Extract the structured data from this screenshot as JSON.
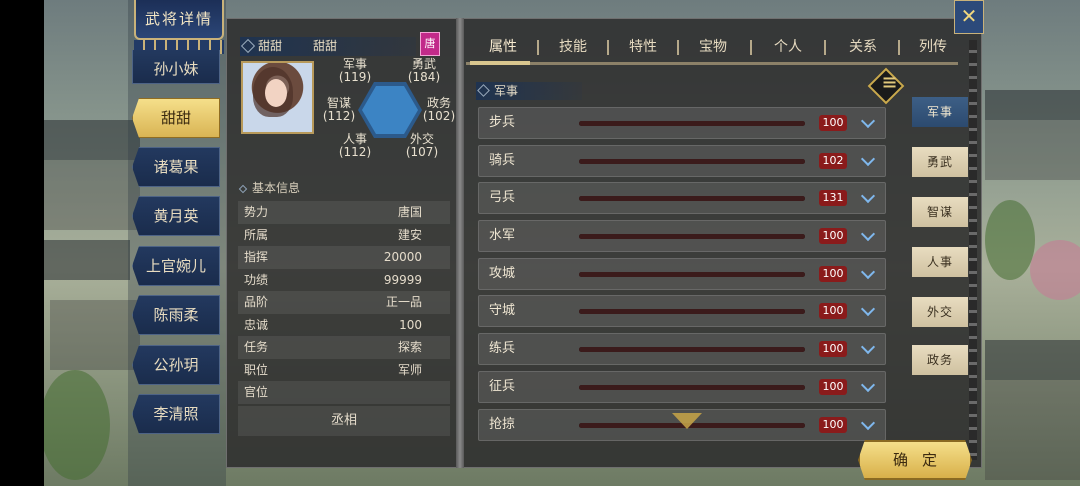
{
  "header": {
    "title": "武将详情"
  },
  "characters": [
    {
      "name": "孙小妹",
      "active": false
    },
    {
      "name": "甜甜",
      "active": true
    },
    {
      "name": "诸葛果",
      "active": false
    },
    {
      "name": "黄月英",
      "active": false
    },
    {
      "name": "上官婉儿",
      "active": false
    },
    {
      "name": "陈雨柔",
      "active": false
    },
    {
      "name": "公孙玥",
      "active": false
    },
    {
      "name": "李清照",
      "active": false
    }
  ],
  "general": {
    "name": "甜甜",
    "alt_name": "甜甜",
    "faction_badge": "唐",
    "stats": {
      "military_label": "军事",
      "military": "(119)",
      "valor_label": "勇武",
      "valor": "(184)",
      "strategy_label": "智谋",
      "strategy": "(112)",
      "politics_label": "政务",
      "politics": "(102)",
      "personnel_label": "人事",
      "personnel": "(112)",
      "diplomacy_label": "外交",
      "diplomacy": "(107)"
    }
  },
  "basic_info": {
    "title": "基本信息",
    "rows": [
      {
        "key": "势力",
        "value": "唐国"
      },
      {
        "key": "所属",
        "value": "建安"
      },
      {
        "key": "指挥",
        "value": "20000"
      },
      {
        "key": "功绩",
        "value": "99999"
      },
      {
        "key": "品阶",
        "value": "正一品"
      },
      {
        "key": "忠诚",
        "value": "100"
      },
      {
        "key": "任务",
        "value": "探索"
      },
      {
        "key": "职位",
        "value": "军师"
      },
      {
        "key": "官位",
        "value": ""
      }
    ],
    "office_value": "丞相"
  },
  "tabs": [
    "属性",
    "技能",
    "特性",
    "宝物",
    "个人",
    "关系",
    "列传"
  ],
  "section": {
    "title": "军事"
  },
  "skills": [
    {
      "name": "步兵",
      "value": "100"
    },
    {
      "name": "骑兵",
      "value": "102"
    },
    {
      "name": "弓兵",
      "value": "131"
    },
    {
      "name": "水军",
      "value": "100"
    },
    {
      "name": "攻城",
      "value": "100"
    },
    {
      "name": "守城",
      "value": "100"
    },
    {
      "name": "练兵",
      "value": "100"
    },
    {
      "name": "征兵",
      "value": "100"
    },
    {
      "name": "抢掠",
      "value": "100"
    }
  ],
  "categories": [
    {
      "label": "军事",
      "active": true
    },
    {
      "label": "勇武",
      "active": false
    },
    {
      "label": "智谋",
      "active": false
    },
    {
      "label": "人事",
      "active": false
    },
    {
      "label": "外交",
      "active": false
    },
    {
      "label": "政务",
      "active": false
    }
  ],
  "buttons": {
    "confirm": "确定",
    "close": "✕"
  }
}
